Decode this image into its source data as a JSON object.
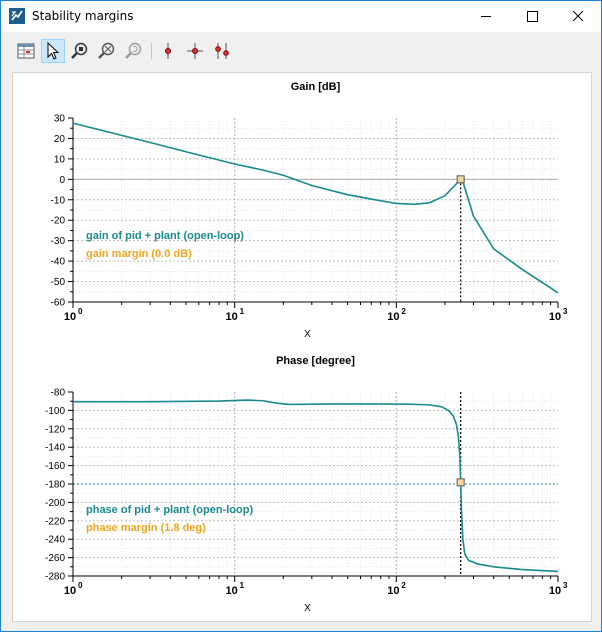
{
  "window": {
    "title": "Stability margins"
  },
  "icons": {
    "app": "app-logo-icon",
    "minimize": "minimize-icon",
    "maximize": "maximize-icon",
    "close": "close-icon",
    "toolbar": [
      "table-view-icon",
      "pointer-icon",
      "zoom-in-icon",
      "zoom-out-icon",
      "zoom-reset-icon",
      "marker-icon",
      "crosshair-marker-icon",
      "dual-marker-icon"
    ]
  },
  "colors": {
    "series": "#1a8a8c",
    "margin": "#f0a51e",
    "grid": "#c8c8c8",
    "axis": "#000000"
  },
  "chart_data": [
    {
      "type": "line",
      "title": "Gain [dB]",
      "xlabel": "X",
      "ylabel": "",
      "xscale": "log",
      "xlim": [
        1,
        1000
      ],
      "ylim": [
        -60,
        30
      ],
      "xticks": [
        1,
        10,
        100,
        1000
      ],
      "xticklabels": [
        [
          "10",
          "0"
        ],
        [
          "10",
          "1"
        ],
        [
          "10",
          "2"
        ],
        [
          "10",
          "3"
        ]
      ],
      "yticks": [
        30,
        20,
        10,
        0,
        -10,
        -20,
        -30,
        -40,
        -50,
        -60
      ],
      "grid": true,
      "legend_position": "bottom-left",
      "series": [
        {
          "name": "gain of pid + plant (open-loop)",
          "x": [
            1,
            2,
            3,
            5,
            10,
            15,
            20,
            30,
            50,
            80,
            100,
            130,
            160,
            200,
            230,
            250,
            260,
            300,
            400,
            600,
            1000
          ],
          "y": [
            27.5,
            21.5,
            18,
            13.5,
            7.5,
            4.5,
            2,
            -3,
            -7.5,
            -10.5,
            -11.8,
            -12.2,
            -11.5,
            -8,
            -3,
            0,
            -2,
            -18,
            -34,
            -44,
            -55.5
          ]
        },
        {
          "name": "gain margin (0.0 dB)",
          "x": [
            250
          ],
          "y": [
            0
          ]
        }
      ],
      "reference_lines": [
        {
          "orientation": "horizontal",
          "value": 0
        },
        {
          "orientation": "vertical",
          "value": 250
        }
      ]
    },
    {
      "type": "line",
      "title": "Phase [degree]",
      "xlabel": "X",
      "ylabel": "",
      "xscale": "log",
      "xlim": [
        1,
        1000
      ],
      "ylim": [
        -280,
        -80
      ],
      "xticks": [
        1,
        10,
        100,
        1000
      ],
      "xticklabels": [
        [
          "10",
          "0"
        ],
        [
          "10",
          "1"
        ],
        [
          "10",
          "2"
        ],
        [
          "10",
          "3"
        ]
      ],
      "yticks": [
        -80,
        -100,
        -120,
        -140,
        -160,
        -180,
        -200,
        -220,
        -240,
        -260,
        -280
      ],
      "grid": true,
      "legend_position": "bottom-left",
      "series": [
        {
          "name": "phase of pid + plant (open-loop)",
          "x": [
            1,
            3,
            8,
            12,
            15,
            18,
            22,
            40,
            80,
            120,
            160,
            190,
            210,
            225,
            235,
            242,
            247,
            250,
            253,
            258,
            265,
            280,
            320,
            400,
            600,
            1000
          ],
          "y": [
            -90.5,
            -90.5,
            -89.8,
            -88.8,
            -89.5,
            -92,
            -93.5,
            -93,
            -93,
            -93.2,
            -94,
            -96,
            -100,
            -106,
            -115,
            -128,
            -150,
            -178,
            -210,
            -240,
            -256,
            -263,
            -267,
            -270,
            -273,
            -275
          ]
        },
        {
          "name": "phase margin (1.8 deg)",
          "x": [
            250
          ],
          "y": [
            -178.2
          ]
        }
      ],
      "reference_lines": [
        {
          "orientation": "horizontal",
          "value": -180
        },
        {
          "orientation": "vertical",
          "value": 250
        }
      ]
    }
  ]
}
